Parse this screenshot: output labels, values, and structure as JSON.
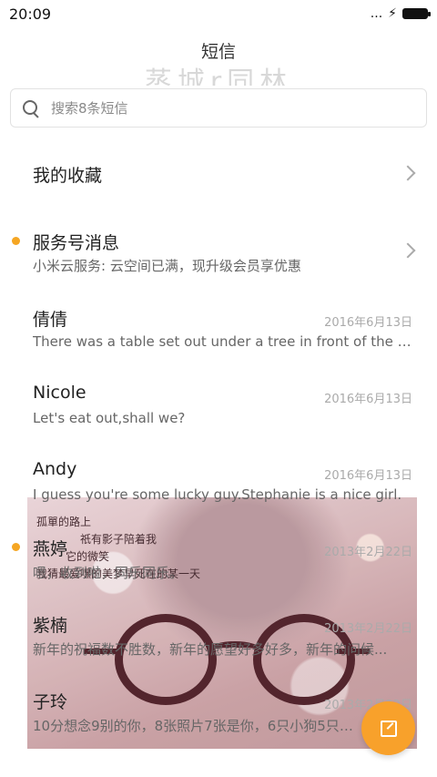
{
  "status_bar": {
    "time": "20:09",
    "dots": "...",
    "charging": "⚡"
  },
  "header": {
    "title": "短信",
    "ghost_text": "蒸城r同林"
  },
  "search": {
    "placeholder": "搜索8条短信"
  },
  "favorites": {
    "label": "我的收藏"
  },
  "conversations": [
    {
      "name": "服务号消息",
      "preview": "小米云服务: 云空间已满，现升级会员享优惠",
      "date": "",
      "unread": true
    },
    {
      "name": "倩倩",
      "preview": "There was a table set out under a tree in front of the ho...",
      "date": "2016年6月13日",
      "unread": false
    },
    {
      "name": "Nicole",
      "preview": "Let's eat out,shall we?",
      "date": "2016年6月13日",
      "unread": false
    },
    {
      "name": "Andy",
      "preview": "I guess you're some lucky guy.Stephanie is a nice girl.",
      "date": "2016年6月13日",
      "unread": false
    },
    {
      "name": "燕婷",
      "preview": "嗯，收到啦，同乐同乐。",
      "date": "2013年2月22日",
      "unread": true
    },
    {
      "name": "紫楠",
      "preview": "新年的祝福数不胜数，新年的愿望好多好多，新年的问候...",
      "date": "2013年2月22日",
      "unread": false
    },
    {
      "name": "子玲",
      "preview": "10分想念9别的你，8张照片7张是你，6只小狗5只像你...",
      "date": "2013年2月22日",
      "unread": false
    }
  ],
  "photo_overlay": {
    "lines": [
      "孤單的路上",
      "祇有影子陪着我",
      "它的微笑",
      "我猜最爱嘿的美梦早死在的某一天"
    ]
  },
  "fab": {
    "icon": "compose-icon"
  },
  "colors": {
    "accent": "#f8a12b",
    "unread_dot": "#f5a623"
  }
}
